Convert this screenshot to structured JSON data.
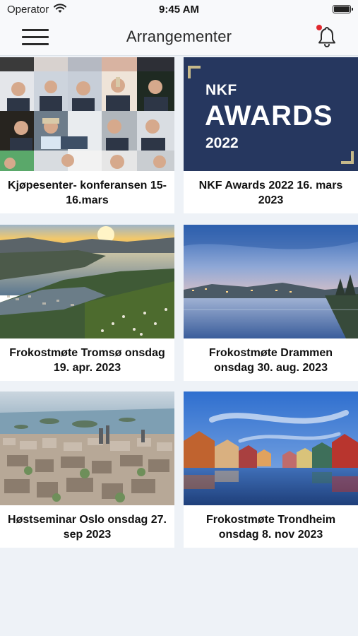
{
  "status_bar": {
    "carrier": "Operator",
    "time": "9:45 AM"
  },
  "nav": {
    "title": "Arrangementer"
  },
  "events": [
    {
      "title": "Kjøpesenter- konferansen 15-16.mars"
    },
    {
      "title": "NKF Awards 2022 16. mars 2023"
    },
    {
      "title": "Frokostmøte Tromsø onsdag 19. apr. 2023"
    },
    {
      "title": "Frokostmøte Drammen onsdag 30. aug. 2023"
    },
    {
      "title": "Høstseminar Oslo onsdag 27. sep 2023"
    },
    {
      "title": "Frokostmøte Trondheim onsdag 8. nov 2023"
    }
  ],
  "awards_banner": {
    "line1": "NKF",
    "line2": "AWARDS",
    "line3": "2022"
  },
  "colors": {
    "accent_red": "#e0282e",
    "awards_navy": "#26375f",
    "awards_gold": "#c6b98a",
    "background": "#eef2f7"
  }
}
